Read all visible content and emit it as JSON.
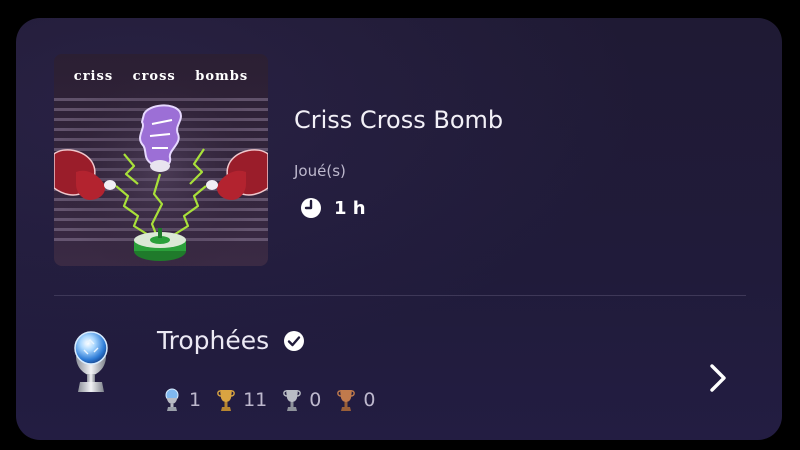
{
  "game": {
    "title": "Criss Cross Bomb",
    "art_title": "criss cross bombs",
    "played_label": "Joué(s)",
    "playtime": "1 h",
    "icons": {
      "clock": "clock-icon"
    }
  },
  "trophies": {
    "title": "Trophées",
    "status_icon": "check-circle-icon",
    "main_icon": "platinum-trophy-icon",
    "counts": [
      {
        "type": "platinum",
        "value": "1",
        "color": "#7fb8f0"
      },
      {
        "type": "gold",
        "value": "11",
        "color": "#d9a441"
      },
      {
        "type": "silver",
        "value": "0",
        "color": "#b9bcc4"
      },
      {
        "type": "bronze",
        "value": "0",
        "color": "#c07a4c"
      }
    ],
    "nav_icon": "chevron-right-icon"
  },
  "colors": {
    "card_background": "#201b3a",
    "text_primary": "#ffffff",
    "text_secondary": "#bdb8cd",
    "divider": "#3e3858"
  }
}
